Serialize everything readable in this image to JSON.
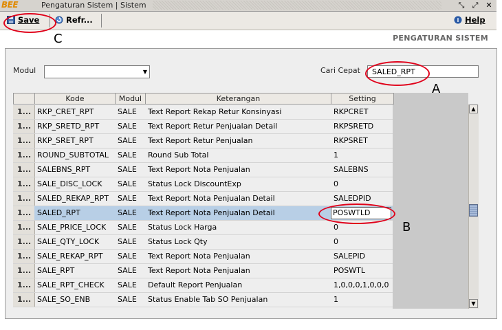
{
  "window": {
    "logo": "BEE",
    "title": "Pengaturan Sistem | Sistem"
  },
  "toolbar": {
    "save_label": "Save",
    "refresh_label": "Refr...",
    "help_label": "Help"
  },
  "section_title": "PENGATURAN SISTEM",
  "filters": {
    "modul_label": "Modul",
    "modul_value": "",
    "search_label": "Cari Cepat",
    "search_value": "SALED_RPT"
  },
  "table": {
    "headers": [
      "Kode",
      "Modul",
      "Keterangan",
      "Setting"
    ],
    "row_number": "1...",
    "selected_index": 7,
    "editing_value": "POSWTLD",
    "rows": [
      [
        "RKP_CRET_RPT",
        "SALE",
        "Text Report Rekap Retur Konsinyasi",
        "RKPCRET"
      ],
      [
        "RKP_SRETD_RPT",
        "SALE",
        "Text Report Retur Penjualan Detail",
        "RKPSRETD"
      ],
      [
        "RKP_SRET_RPT",
        "SALE",
        "Text Report Retur Penjualan",
        "RKPSRET"
      ],
      [
        "ROUND_SUBTOTAL",
        "SALE",
        "Round Sub Total",
        "1"
      ],
      [
        "SALEBNS_RPT",
        "SALE",
        "Text Report Nota Penjualan",
        "SALEBNS"
      ],
      [
        "SALE_DISC_LOCK",
        "SALE",
        "Status Lock DiscountExp",
        "0"
      ],
      [
        "SALED_REKAP_RPT",
        "SALE",
        "Text Report Nota Penjualan Detail",
        "SALEDPID"
      ],
      [
        "SALED_RPT",
        "SALE",
        "Text Report Nota Penjualan Detail",
        "POSWTLD"
      ],
      [
        "SALE_PRICE_LOCK",
        "SALE",
        "Status Lock Harga",
        "0"
      ],
      [
        "SALE_QTY_LOCK",
        "SALE",
        "Status Lock Qty",
        "0"
      ],
      [
        "SALE_REKAP_RPT",
        "SALE",
        "Text Report Nota Penjualan",
        "SALEPID"
      ],
      [
        "SALE_RPT",
        "SALE",
        "Text Report Nota Penjualan",
        "POSWTL"
      ],
      [
        "SALE_RPT_CHECK",
        "SALE",
        "Default Report Penjualan",
        "1,0,0,0,1,0,0,0"
      ],
      [
        "SALE_SO_ENB",
        "SALE",
        "Status Enable Tab SO Penjualan",
        "1"
      ]
    ]
  },
  "annotations": {
    "a": "A",
    "b": "B",
    "c": "C"
  },
  "colors": {
    "annotation_ring": "#e0001a",
    "selected_row": "#b8cfe6"
  }
}
